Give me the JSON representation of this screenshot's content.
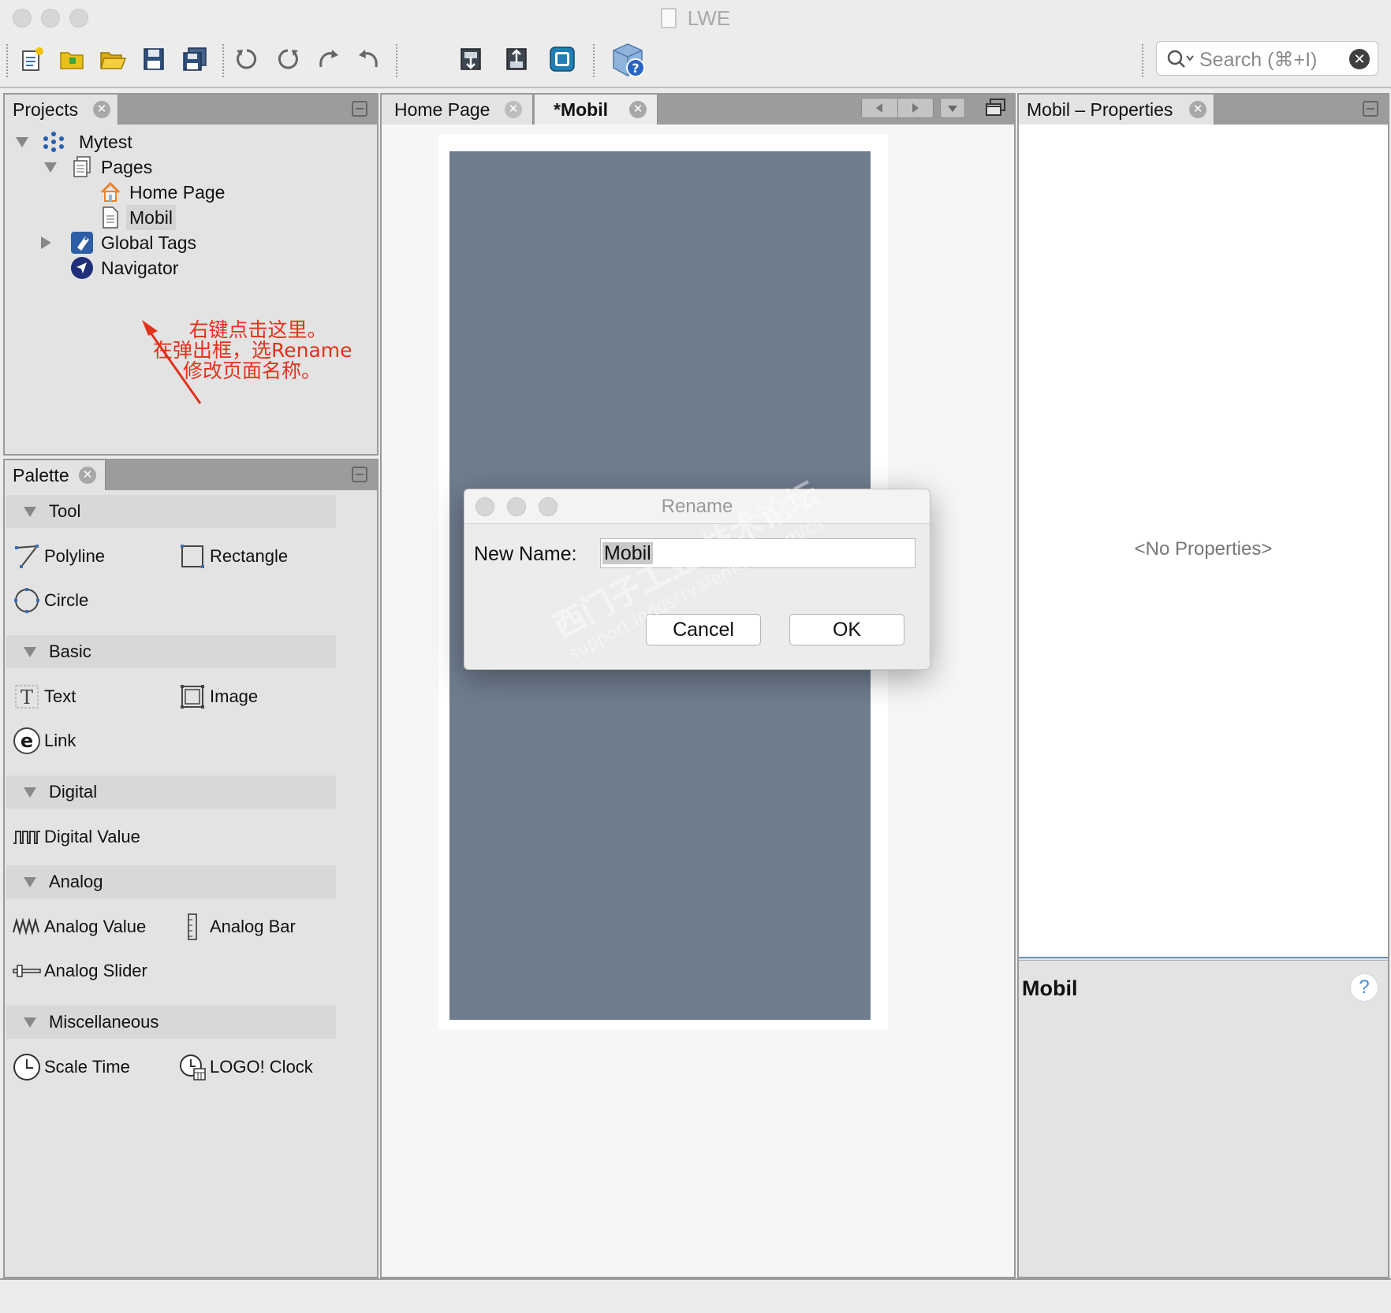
{
  "window": {
    "title": "LWE"
  },
  "toolbar": {
    "buttons": [
      "new-project-icon",
      "new-folder-icon",
      "open-icon",
      "save-icon",
      "save-all-icon",
      "undo-icon",
      "redo-icon",
      "redo-alt-icon",
      "undo-alt-icon",
      "download-icon",
      "upload-icon",
      "simulate-icon",
      "help-cube-icon"
    ],
    "search_placeholder": "Search (⌘+I)"
  },
  "projects": {
    "tab_label": "Projects",
    "tree": {
      "root": "Mytest",
      "pages": "Pages",
      "home_page": "Home Page",
      "mobil": "Mobil",
      "global_tags": "Global Tags",
      "navigator": "Navigator"
    },
    "annotation": [
      "右键点击这里。",
      "在弹出框，选Rename",
      "修改页面名称。"
    ]
  },
  "palette": {
    "tab_label": "Palette",
    "categories": {
      "tool": "Tool",
      "basic": "Basic",
      "digital": "Digital",
      "analog": "Analog",
      "misc": "Miscellaneous"
    },
    "items": {
      "polyline": "Polyline",
      "rectangle": "Rectangle",
      "circle": "Circle",
      "text": "Text",
      "image": "Image",
      "link": "Link",
      "digital_value": "Digital Value",
      "analog_value": "Analog Value",
      "analog_bar": "Analog Bar",
      "analog_slider": "Analog Slider",
      "scale_time": "Scale Time",
      "logo_clock": "LOGO! Clock"
    }
  },
  "editor": {
    "tabs": [
      "Home Page",
      "*Mobil"
    ],
    "page_color": "#6f7d8f"
  },
  "dialog": {
    "title": "Rename",
    "label": "New Name:",
    "value": "Mobil",
    "cancel": "Cancel",
    "ok": "OK"
  },
  "watermark": {
    "line1": "西门子工业 技术论坛",
    "line2": "support.industry.siemens.com/cs"
  },
  "properties": {
    "tab_label": "Mobil – Properties",
    "empty_text": "<No Properties>",
    "desc_title": "Mobil",
    "help": "?"
  }
}
